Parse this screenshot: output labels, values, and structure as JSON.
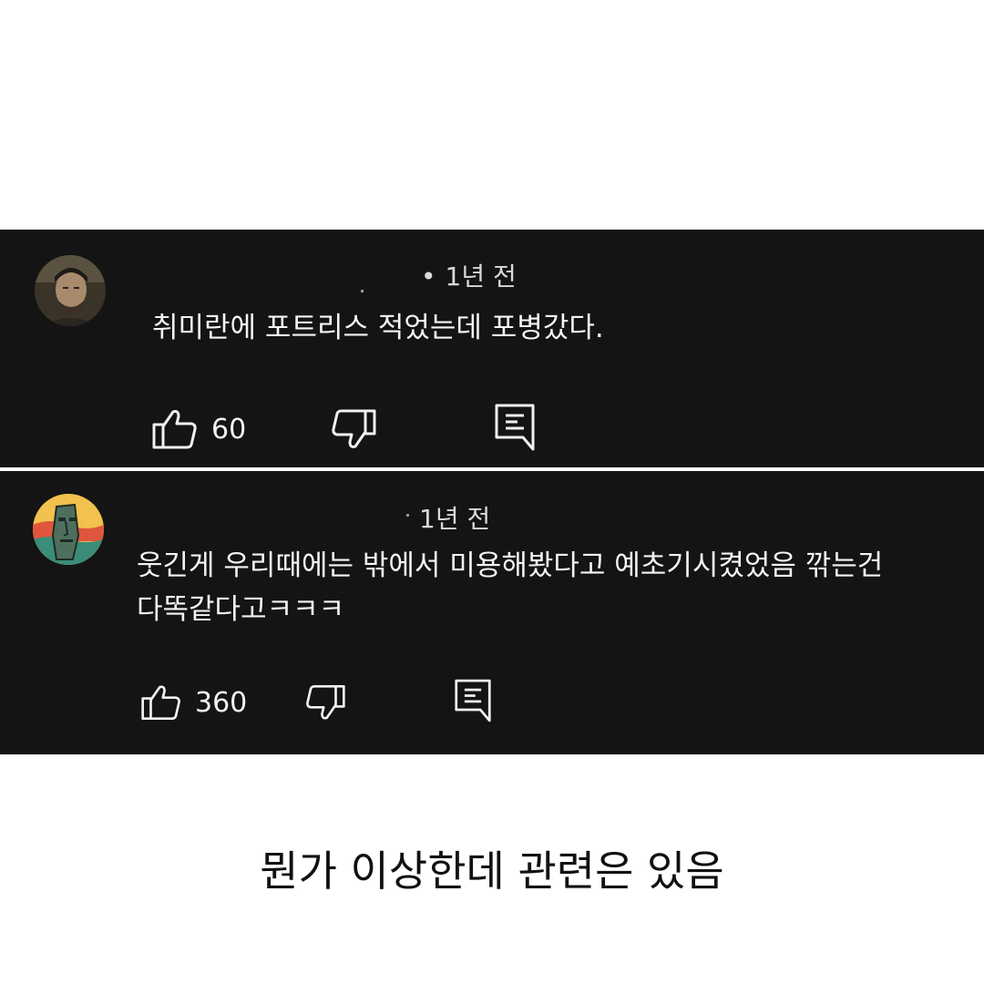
{
  "comments": [
    {
      "avatar": "man-portrait-avatar",
      "time": "1년 전",
      "text_lines": [
        "취미란에 포트리스 적었는데 포병갔다."
      ],
      "likes": "60",
      "icons": {
        "like": "thumbs-up-icon",
        "dislike": "thumbs-down-icon",
        "reply": "reply-comment-icon"
      }
    },
    {
      "avatar": "moai-statue-avatar",
      "time": "1년 전",
      "text_lines": [
        "웃긴게 우리때에는 밖에서 미용해봤다고 예초기시켰었음 깎는건",
        "다똑같다고ㅋㅋㅋ"
      ],
      "likes": "360",
      "icons": {
        "like": "thumbs-up-icon",
        "dislike": "thumbs-down-icon",
        "reply": "reply-comment-icon"
      }
    }
  ],
  "caption": "뭔가 이상한데 관련은 있음",
  "colors": {
    "panel": "#141414",
    "text": "#f1f1f1",
    "page": "#ffffff"
  }
}
